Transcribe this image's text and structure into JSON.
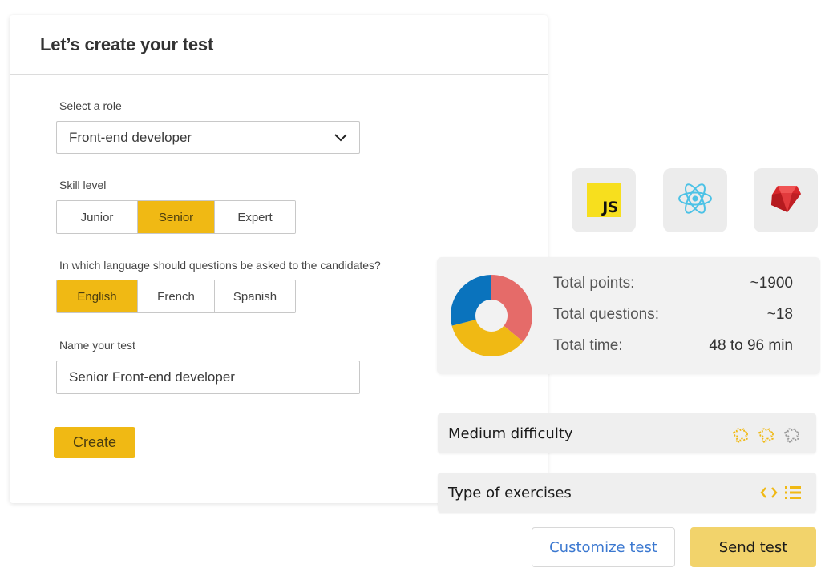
{
  "card": {
    "title": "Let’s create your test",
    "role": {
      "label": "Select a role",
      "selected": "Front-end developer"
    },
    "skill_level": {
      "label": "Skill level",
      "options": [
        "Junior",
        "Senior",
        "Expert"
      ],
      "selected": "Senior"
    },
    "language": {
      "label": "In which language should questions be asked to the candidates?",
      "options": [
        "English",
        "French",
        "Spanish"
      ],
      "selected": "English"
    },
    "test_name": {
      "label": "Name your test",
      "value": "Senior Front-end developer"
    },
    "create_label": "Create"
  },
  "technologies": [
    {
      "name": "JavaScript",
      "icon": "javascript-icon",
      "badge_text": "JS"
    },
    {
      "name": "React",
      "icon": "react-icon"
    },
    {
      "name": "Ruby",
      "icon": "ruby-icon"
    }
  ],
  "stats": {
    "rows": [
      {
        "label": "Total points:",
        "value": "~1900"
      },
      {
        "label": "Total questions:",
        "value": "~18"
      },
      {
        "label": "Total time:",
        "value": "48 to 96 min"
      }
    ]
  },
  "chart_data": {
    "type": "pie",
    "variant": "donut",
    "title": "",
    "slices": [
      {
        "label": "segment-red",
        "value": 36,
        "color": "#e56b69"
      },
      {
        "label": "segment-yellow",
        "value": 35,
        "color": "#f0b914"
      },
      {
        "label": "segment-blue",
        "value": 29,
        "color": "#0a73bd"
      }
    ],
    "start": "12 o'clock",
    "direction": "clockwise"
  },
  "difficulty": {
    "label": "Medium difficulty",
    "level": 2,
    "max": 3,
    "active_color": "#f0b914",
    "inactive_color": "#9a9a9a"
  },
  "exercises": {
    "label": "Type of exercises",
    "types": [
      "code-icon",
      "list-icon"
    ],
    "color": "#f0b914"
  },
  "actions": {
    "customize_label": "Customize test",
    "send_label": "Send test"
  },
  "colors": {
    "accent": "#f0b914",
    "link": "#3b78d0",
    "send_button": "#f2d36b"
  }
}
